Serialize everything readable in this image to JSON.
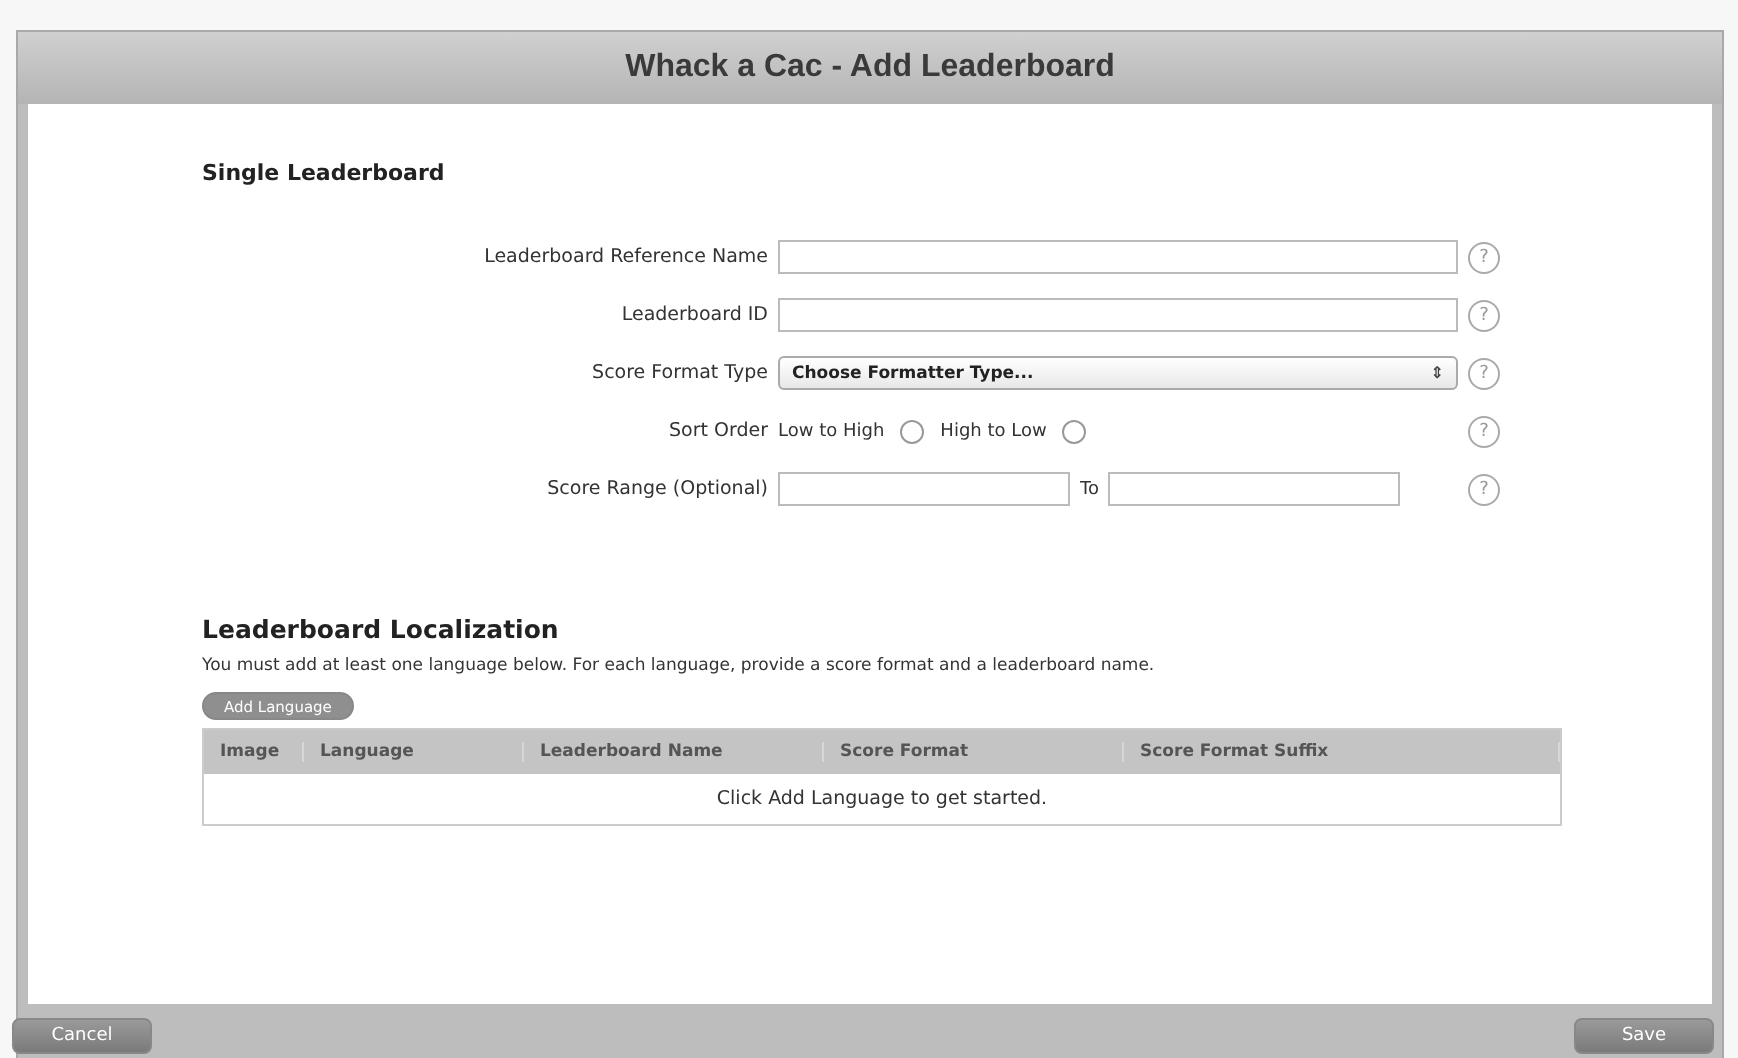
{
  "window": {
    "title": "Whack a Cac - Add Leaderboard"
  },
  "single_leaderboard": {
    "heading": "Single Leaderboard",
    "fields": [
      {
        "kind": "text",
        "label": "Leaderboard Reference Name"
      },
      {
        "kind": "text",
        "label": "Leaderboard ID"
      },
      {
        "kind": "select",
        "label": "Score Format Type",
        "value": "Choose Formatter Type...",
        "caret": "⇕"
      },
      {
        "kind": "radios",
        "label": "Sort Order",
        "options": [
          {
            "label": "Low to High",
            "selected": false
          },
          {
            "label": "High to Low",
            "selected": false
          }
        ]
      },
      {
        "kind": "range",
        "label": "Score Range (Optional)",
        "joiner": "To"
      }
    ],
    "help": "?"
  },
  "localization": {
    "heading": "Leaderboard Localization",
    "note": "You must add at least one language below. For each language, provide a score format and a leaderboard name.",
    "add_button": {
      "label": "Add Language",
      "disabled": true
    },
    "table": {
      "columns": [
        "Image",
        "Language",
        "Leaderboard Name",
        "Score Format",
        "Score Format Suffix"
      ],
      "empty": "Click Add Language to get started."
    }
  },
  "footer": {
    "buttons": [
      {
        "label": "Cancel"
      },
      {
        "label": "Save"
      }
    ]
  }
}
